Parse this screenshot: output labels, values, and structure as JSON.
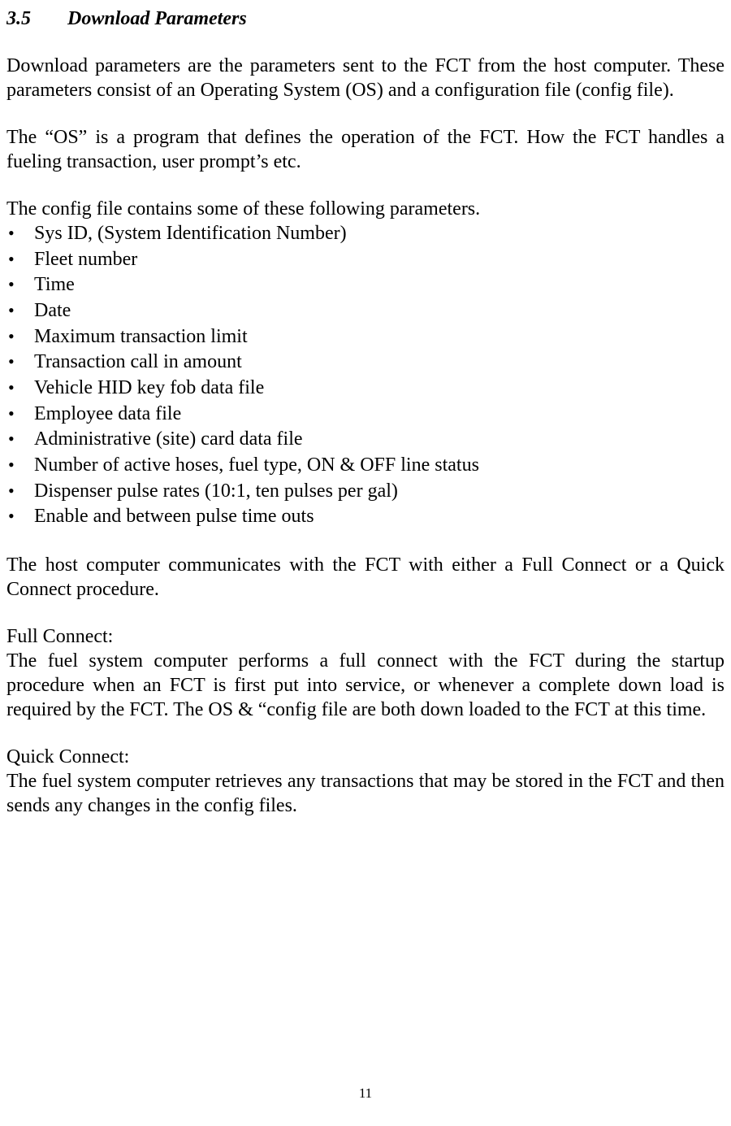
{
  "heading": {
    "number": "3.5",
    "title": "Download Parameters"
  },
  "para1": "Download parameters are the parameters sent to the FCT from the host computer. These parameters consist of an Operating System (OS) and a configuration file (config file).",
  "para2": "The “OS” is a program that defines the operation of the FCT. How the FCT handles a fueling transaction, user prompt’s etc.",
  "listIntro": "The config file contains some of these following parameters.",
  "bullets": [
    "Sys ID, (System Identification Number)",
    "Fleet number",
    "Time",
    "Date",
    "Maximum transaction limit",
    "Transaction call in amount",
    "Vehicle HID key fob data file",
    "Employee data file",
    "Administrative (site) card data file",
    "Number of active hoses, fuel type, ON & OFF line status",
    "Dispenser pulse rates (10:1, ten pulses per gal)",
    "Enable and between pulse time outs"
  ],
  "para3": "The host computer communicates with the FCT with either a Full Connect or a Quick Connect procedure.",
  "fullConnect": {
    "label": "Full Connect:",
    "text": "The fuel system computer performs a full connect with the FCT during the startup procedure when an FCT is first put into service, or whenever a complete down load is required by the FCT. The OS & “config file are both down loaded to the FCT at this time."
  },
  "quickConnect": {
    "label": "Quick Connect:",
    "text": "The fuel system computer retrieves any transactions that may be stored in the FCT and then sends any changes in the config files."
  },
  "pageNumber": "11"
}
